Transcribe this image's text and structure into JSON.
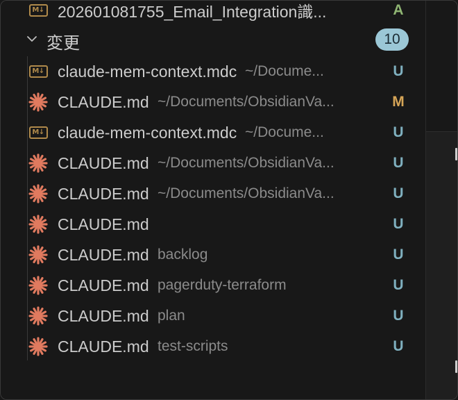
{
  "top_item": {
    "name": "202601081755_Email_Integration識...",
    "status": "A",
    "icon": "markdown-icon"
  },
  "section": {
    "title": "変更",
    "count": "10"
  },
  "changes": [
    {
      "name": "claude-mem-context.mdc",
      "path": "~/Docume...",
      "status": "U",
      "icon": "markdown-icon"
    },
    {
      "name": "CLAUDE.md",
      "path": "~/Documents/ObsidianVa...",
      "status": "M",
      "icon": "claude-icon"
    },
    {
      "name": "claude-mem-context.mdc",
      "path": "~/Docume...",
      "status": "U",
      "icon": "markdown-icon"
    },
    {
      "name": "CLAUDE.md",
      "path": "~/Documents/ObsidianVa...",
      "status": "U",
      "icon": "claude-icon"
    },
    {
      "name": "CLAUDE.md",
      "path": "~/Documents/ObsidianVa...",
      "status": "U",
      "icon": "claude-icon"
    },
    {
      "name": "CLAUDE.md",
      "path": "",
      "status": "U",
      "icon": "claude-icon"
    },
    {
      "name": "CLAUDE.md",
      "path": "backlog",
      "status": "U",
      "icon": "claude-icon"
    },
    {
      "name": "CLAUDE.md",
      "path": "pagerduty-terraform",
      "status": "U",
      "icon": "claude-icon"
    },
    {
      "name": "CLAUDE.md",
      "path": "plan",
      "status": "U",
      "icon": "claude-icon"
    },
    {
      "name": "CLAUDE.md",
      "path": "test-scripts",
      "status": "U",
      "icon": "claude-icon"
    }
  ],
  "colors": {
    "background": "#181818",
    "claude_icon": "#e07a5f",
    "markdown_icon": "#b08a4b",
    "status_untracked": "#7fb0bf",
    "status_modified": "#d6a557",
    "status_added": "#8fb573",
    "badge": "#9bc7d6"
  }
}
